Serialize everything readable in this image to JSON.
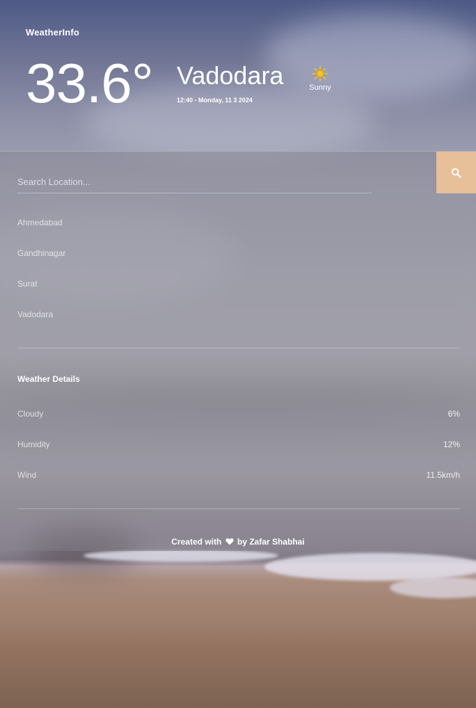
{
  "app": {
    "brand": "WeatherInfo"
  },
  "current": {
    "temperature": "33.6°",
    "city": "Vadodara",
    "datetime": "12:40 - Monday, 11 3 2024",
    "condition": "Sunny",
    "condition_icon": "sun-icon",
    "condition_icon_color": "#f5c518"
  },
  "search": {
    "placeholder": "Search Location...",
    "value": "",
    "button_icon": "search-icon",
    "button_color": "#e7bf98"
  },
  "locations": [
    "Ahmedabad",
    "Gandhinagar",
    "Surat",
    "Vadodara"
  ],
  "details": {
    "title": "Weather Details",
    "rows": [
      {
        "label": "Cloudy",
        "value": "6%"
      },
      {
        "label": "Humidity",
        "value": "12%"
      },
      {
        "label": "Wind",
        "value": "11.5km/h"
      }
    ]
  },
  "footer": {
    "prefix": "Created with",
    "icon": "heart-icon",
    "suffix": "by Zafar Shabhai"
  }
}
